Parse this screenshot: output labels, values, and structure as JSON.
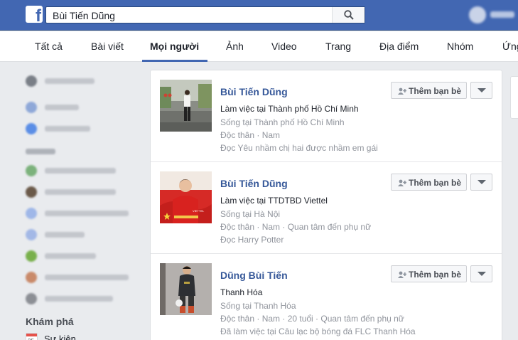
{
  "search": {
    "query": "Bùi Tiến Dũng"
  },
  "tabs": [
    "Tất cả",
    "Bài viết",
    "Mọi người",
    "Ảnh",
    "Video",
    "Trang",
    "Địa điểm",
    "Nhóm",
    "Ứng"
  ],
  "active_tab": "Mọi người",
  "sidebar": {
    "explore_heading": "Khám phá",
    "events_label": "Sự kiện",
    "calendar_day": "25"
  },
  "results": [
    {
      "name": "Bùi Tiến Dũng",
      "lines": [
        "Làm việc tại Thành phố Hồ Chí Minh",
        "Sống tại Thành phố Hồ Chí Minh",
        "Độc thân · Nam",
        "Đọc Yêu nhầm chị hai được nhầm em gái"
      ],
      "add_friend_label": "Thêm bạn bè"
    },
    {
      "name": "Bùi Tiến Dũng",
      "lines": [
        "Làm việc tại TTDTBD Viettel",
        "Sống tại Hà Nội",
        "Độc thân · Nam · Quan tâm đến phụ nữ",
        "Đọc Harry Potter"
      ],
      "add_friend_label": "Thêm bạn bè"
    },
    {
      "name": "Dũng Bùi Tiến",
      "lines": [
        "Thanh Hóa",
        "Sống tại Thanh Hóa",
        "Độc thân · Nam · 20 tuổi · Quan tâm đến phụ nữ",
        "Đã làm việc tại Câu lạc bộ bóng đá FLC Thanh Hóa"
      ],
      "add_friend_label": "Thêm bạn bè"
    }
  ],
  "colors": {
    "brand_blue": "#4267b2",
    "link_blue": "#365899",
    "secondary_text": "#90949c"
  }
}
